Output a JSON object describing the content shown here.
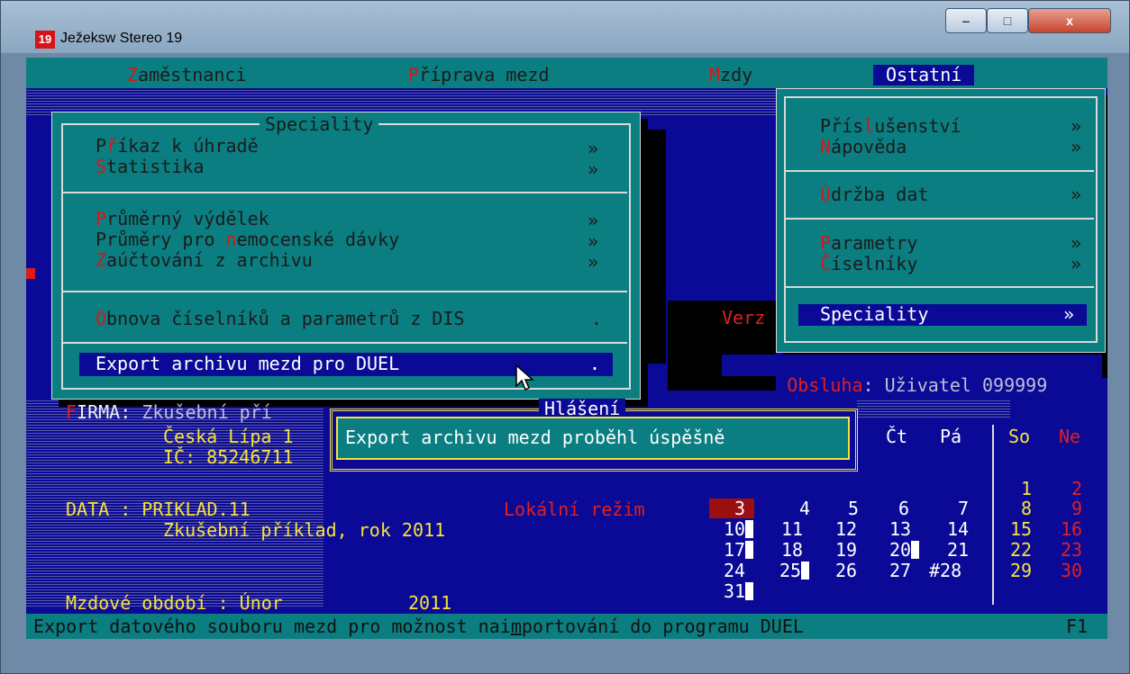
{
  "window": {
    "icon_label": "19",
    "title": "Ježeksw Stereo 19",
    "min": "‒",
    "max": "□",
    "close": "x"
  },
  "menubar": [
    {
      "hotkey": "Z",
      "rest": "aměstnanci"
    },
    {
      "hotkey": "P",
      "rest": "říprava mezd"
    },
    {
      "hotkey": "M",
      "rest": "zdy"
    },
    {
      "hotkey": "",
      "rest": "Ostatní"
    }
  ],
  "ostatni_menu": {
    "items": [
      {
        "pre": "Přís",
        "hk": "l",
        "post": "ušenství",
        "arrow": "»"
      },
      {
        "pre": "",
        "hk": "N",
        "post": "ápověda",
        "arrow": "»"
      },
      {
        "pre": "",
        "hk": "Ú",
        "post": "držba dat",
        "arrow": "»"
      },
      {
        "pre": "",
        "hk": "P",
        "post": "arametry",
        "arrow": "»"
      },
      {
        "pre": "",
        "hk": "Č",
        "post": "íselníky",
        "arrow": "»"
      },
      {
        "pre": "",
        "hk": "S",
        "post": "peciality",
        "arrow": "»"
      }
    ]
  },
  "speciality_menu": {
    "title": "Speciality",
    "items": [
      {
        "pre": "P",
        "hk": "ř",
        "post": "íkaz k úhradě",
        "arrow": "»"
      },
      {
        "pre": "",
        "hk": "S",
        "post": "tatistika",
        "arrow": "»"
      },
      {
        "pre": "",
        "hk": "P",
        "post": "růměrný výdělek",
        "arrow": "»"
      },
      {
        "pre": "Průměry pro ",
        "hk": "n",
        "post": "emocenské dávky",
        "arrow": "»"
      },
      {
        "pre": "",
        "hk": "Z",
        "post": "aúčtování z archivu",
        "arrow": "»"
      },
      {
        "pre": "",
        "hk": "O",
        "post": "bnova číselníků a parametrů z DIS",
        "arrow": "."
      },
      {
        "pre": "",
        "hk": "E",
        "post": "xport archivu mezd pro DUEL",
        "arrow": "."
      }
    ]
  },
  "dialog": {
    "title": "Hlášení",
    "message": "Export archivu mezd proběhl úspěšně"
  },
  "info": {
    "firma_hk": "F",
    "firma_label": "IRMA:",
    "firma_value": "Zkušební pří",
    "city": "Česká Lípa 1",
    "ic": "IČ: 85246711",
    "data_label": "DATA : PRIKLAD.11",
    "data_desc": "Zkušební příklad, rok 2011",
    "mode": "Lokální režim",
    "version_label": "Verz",
    "obsluha_label": "Obsluha",
    "obsluha_value": ": Uživatel 099999",
    "period_label": "Mzdové období : Únor",
    "period_year": "2011"
  },
  "calendar": {
    "headers": [
      "Čt",
      "Pá",
      "So",
      "Ne"
    ],
    "rows": [
      [
        "",
        "",
        "",
        "",
        "",
        "1",
        "2"
      ],
      [
        "3",
        "4",
        "5",
        "6",
        "7",
        "8",
        "9"
      ],
      [
        "10",
        "11",
        "12",
        "13",
        "14",
        "15",
        "16"
      ],
      [
        "17",
        "18",
        "19",
        "20",
        "21",
        "22",
        "23"
      ],
      [
        "24",
        "25",
        "26",
        "27",
        "#28",
        "29",
        "30"
      ],
      [
        "31",
        "",
        "",
        "",
        "",
        "",
        ""
      ]
    ]
  },
  "statusbar": {
    "text_pre": "Export datového souboru mezd pro možnost nai",
    "text_hk": "m",
    "text_post": "portování do programu DUEL",
    "key": "F1"
  }
}
